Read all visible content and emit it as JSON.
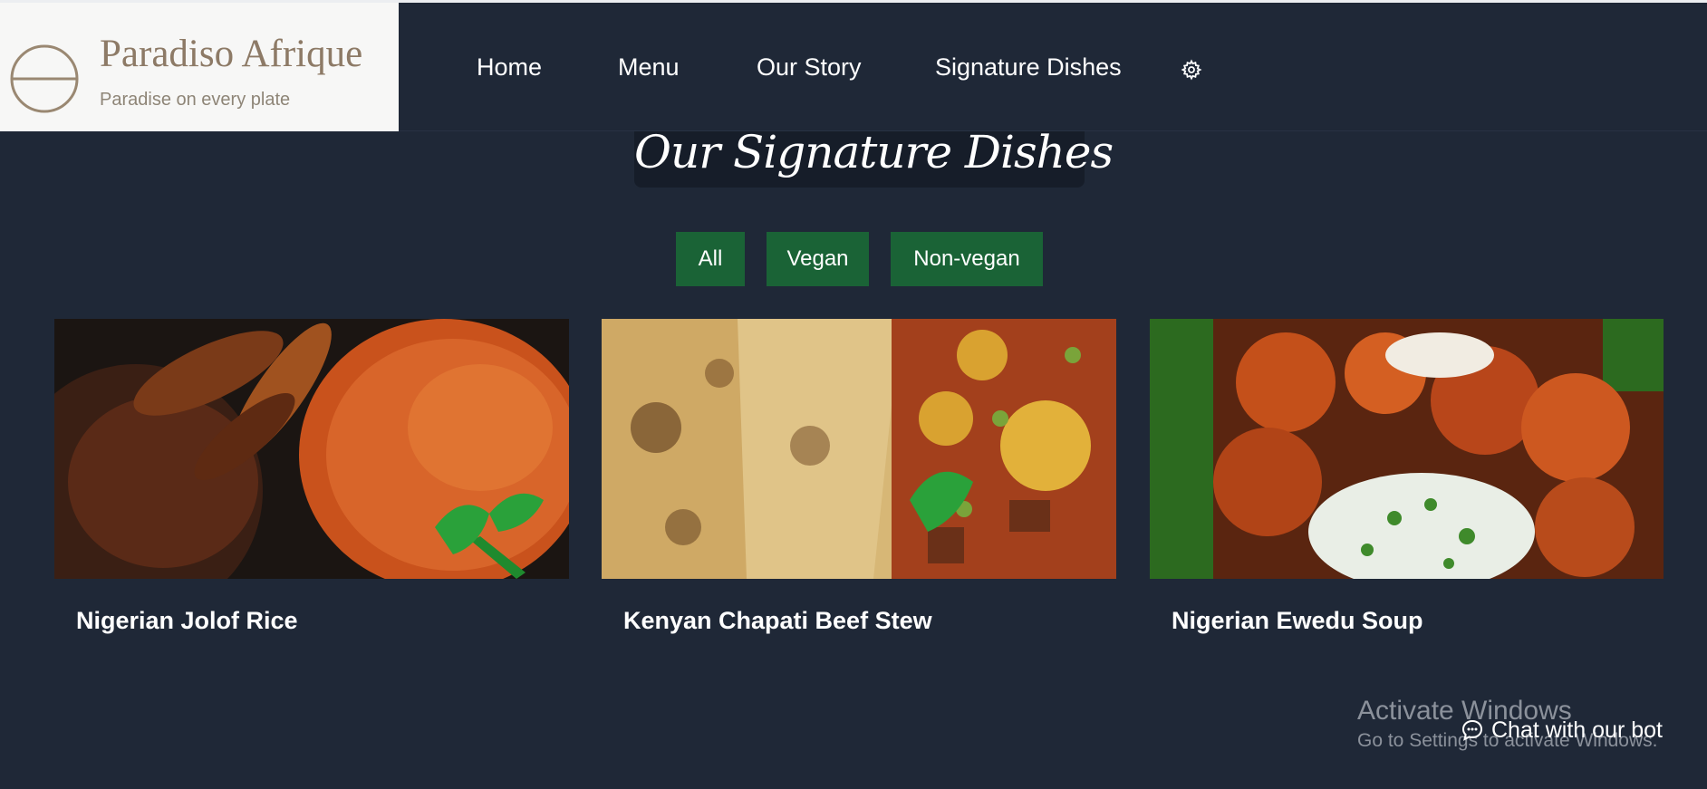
{
  "brand": {
    "name": "Paradiso Afrique",
    "tagline": "Paradise on every plate"
  },
  "nav": {
    "items": [
      {
        "label": "Home"
      },
      {
        "label": "Menu"
      },
      {
        "label": "Our Story"
      },
      {
        "label": "Signature Dishes"
      }
    ],
    "settings_icon": "gear-icon"
  },
  "section": {
    "title": "Our Signature Dishes"
  },
  "filters": [
    {
      "label": "All"
    },
    {
      "label": "Vegan"
    },
    {
      "label": "Non-vegan"
    }
  ],
  "dishes": [
    {
      "name": "Nigerian Jolof Rice"
    },
    {
      "name": "Kenyan Chapati Beef Stew"
    },
    {
      "name": "Nigerian Ewedu Soup"
    }
  ],
  "chat": {
    "label": "Chat with our bot",
    "icon": "chat-bubble-icon"
  },
  "watermark": {
    "title": "Activate Windows",
    "subtitle": "Go to Settings to activate Windows."
  },
  "colors": {
    "page_bg": "#1f2837",
    "filter_bg": "#1a6336",
    "brand_text": "#8d7a66"
  }
}
